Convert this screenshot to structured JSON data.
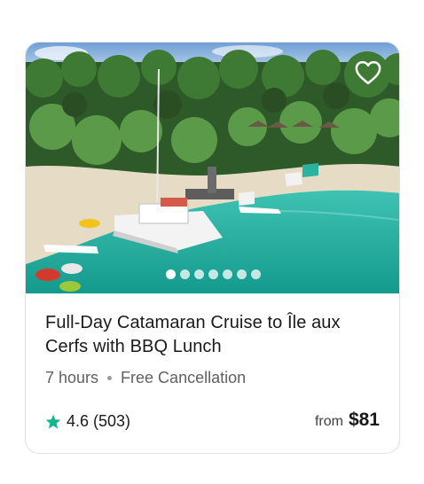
{
  "card": {
    "title": "Full-Day Catamaran Cruise to Île aux Cerfs with BBQ Lunch",
    "duration": "7 hours",
    "cancellation": "Free Cancellation",
    "rating": "4.6",
    "reviews": "(503)",
    "price_prefix": "from",
    "price": "$81",
    "gallery_count": 7,
    "gallery_active_index": 0,
    "icons": {
      "favorite": "heart-outline-icon",
      "rating": "star-icon"
    },
    "colors": {
      "star": "#13b58c",
      "sea": "#1aa99a"
    }
  }
}
